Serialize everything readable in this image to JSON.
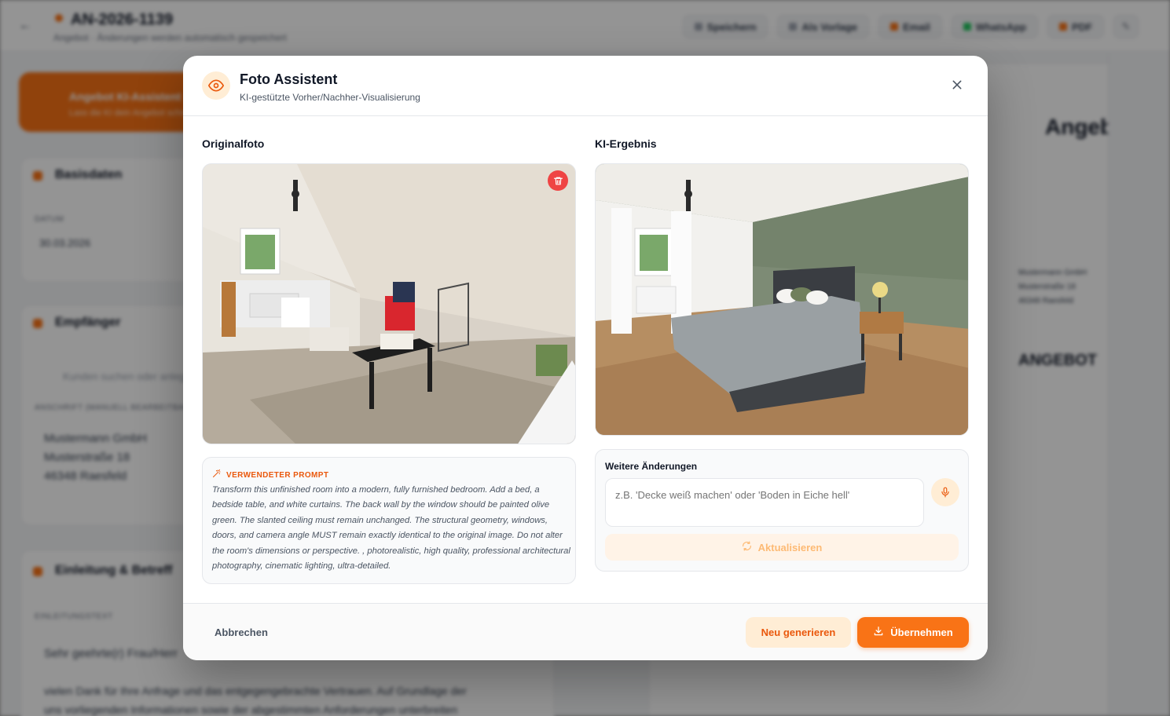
{
  "background": {
    "doc_number": "AN-2026-1139",
    "doc_subtitle": "Angebot · Änderungen werden automatisch gespeichert",
    "actions": [
      "Speichern",
      "Als Vorlage",
      "Email",
      "WhatsApp",
      "PDF"
    ],
    "banner_title": "Angebot KI-Assistent",
    "banner_sub": "Lass die KI dein Angebot schreiben",
    "section_details": "Basisdaten",
    "date_label": "Datum",
    "date_value": "30.03.2026",
    "section_recipient": "Empfänger",
    "recipient_search": "Kunden suchen oder anlegen...",
    "address_label": "Anschrift (manuell bearbeitbar)",
    "address_lines": [
      "Mustermann GmbH",
      "Musterstraße 18",
      "46348 Raesfeld"
    ],
    "section_intro": "Einleitung & Betreff",
    "intro_label": "Einleitungstext",
    "intro_line1": "Sehr geehrte(r) Frau/Herr",
    "intro_line2": "vielen Dank für Ihre Anfrage und das entgegengebrachte Vertrauen. Auf Grundlage der",
    "intro_line3": "uns vorliegenden Informationen sowie der abgestimmten Anforderungen unterbreiten",
    "doc_heading": "Angebot",
    "doc_company": "Mustermann GmbH",
    "doc_street": "Musterstraße 18",
    "doc_city": "46348 Raesfeld",
    "doc_big": "ANGEBOT"
  },
  "modal": {
    "title": "Foto Assistent",
    "subtitle": "KI-gestützte Vorher/Nachher-Visualisierung",
    "original_label": "Originalfoto",
    "result_label": "KI-Ergebnis",
    "prompt_label": "VERWENDETER PROMPT",
    "prompt_text": "Transform this unfinished room into a modern, fully furnished bedroom. Add a bed, a bedside table, and white curtains. The back wall by the window should be painted olive green. The slanted ceiling must remain unchanged. The structural geometry, windows, doors, and camera angle MUST remain exactly identical to the original image. Do not alter the room's dimensions or perspective. , photorealistic, high quality, professional architectural photography, cinematic lighting, ultra-detailed.",
    "changes_label": "Weitere Änderungen",
    "changes_placeholder": "z.B. 'Decke weiß machen' oder 'Boden in Eiche hell'",
    "update_label": "Aktualisieren",
    "cancel_label": "Abbrechen",
    "regenerate_label": "Neu generieren",
    "apply_label": "Übernehmen"
  },
  "colors": {
    "accent": "#f97316",
    "accent_light": "#ffedd5",
    "accent_text": "#ea580c",
    "delete": "#ef4444",
    "olive_wall": "#7d8b75"
  },
  "icons": {
    "header": "eye-icon",
    "close": "close-icon",
    "delete": "trash-icon",
    "prompt": "magic-wand-icon",
    "mic": "microphone-icon",
    "update": "refresh-icon",
    "apply": "download-icon"
  }
}
